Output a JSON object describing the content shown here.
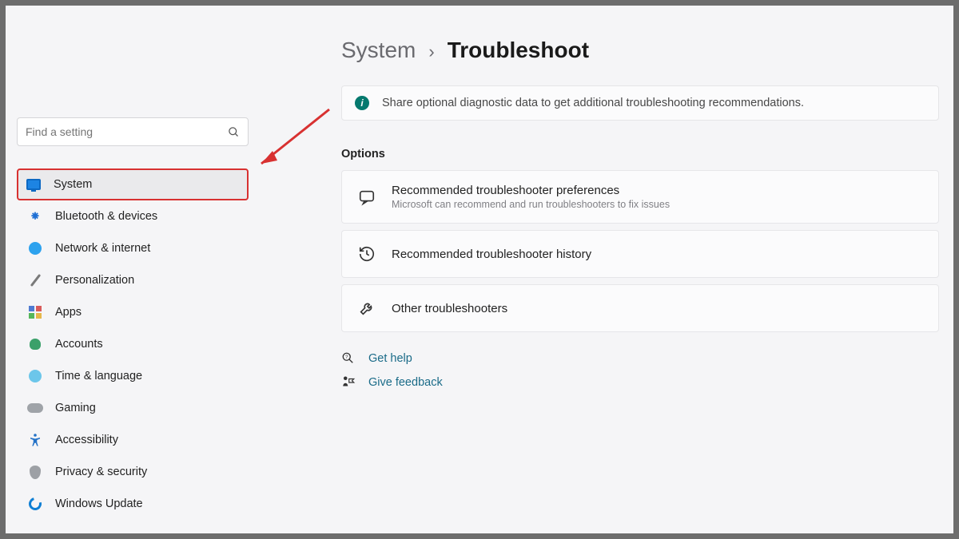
{
  "sidebar": {
    "search": {
      "placeholder": "Find a setting"
    },
    "items": [
      {
        "label": "System"
      },
      {
        "label": "Bluetooth & devices"
      },
      {
        "label": "Network & internet"
      },
      {
        "label": "Personalization"
      },
      {
        "label": "Apps"
      },
      {
        "label": "Accounts"
      },
      {
        "label": "Time & language"
      },
      {
        "label": "Gaming"
      },
      {
        "label": "Accessibility"
      },
      {
        "label": "Privacy & security"
      },
      {
        "label": "Windows Update"
      }
    ]
  },
  "breadcrumb": {
    "parent": "System",
    "sep": "›",
    "current": "Troubleshoot"
  },
  "banner": {
    "text": "Share optional diagnostic data to get additional troubleshooting recommendations."
  },
  "section_label": "Options",
  "cards": [
    {
      "title": "Recommended troubleshooter preferences",
      "sub": "Microsoft can recommend and run troubleshooters to fix issues"
    },
    {
      "title": "Recommended troubleshooter history",
      "sub": ""
    },
    {
      "title": "Other troubleshooters",
      "sub": ""
    }
  ],
  "help_links": [
    {
      "label": "Get help"
    },
    {
      "label": "Give feedback"
    }
  ]
}
